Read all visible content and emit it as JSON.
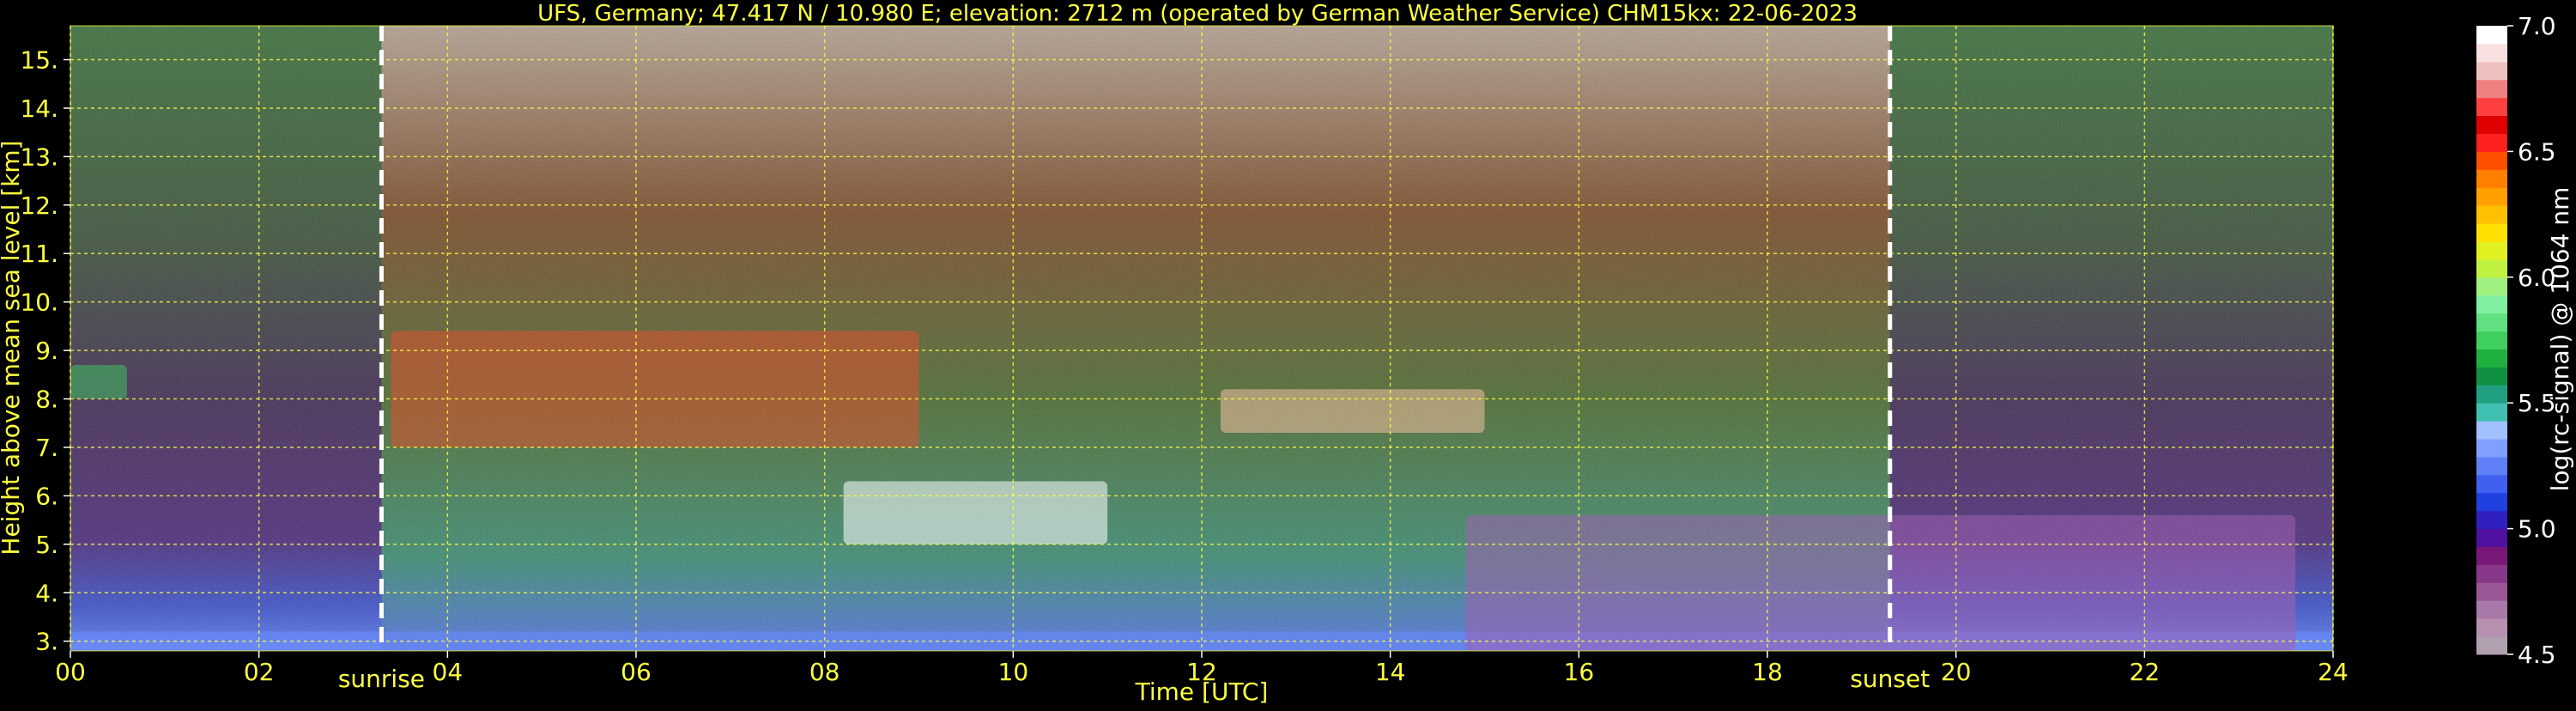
{
  "chart_data": {
    "type": "heatmap",
    "title": "UFS, Germany; 47.417 N / 10.980 E; elevation: 2712 m  (operated by German Weather Service)    CHM15kx: 22-06-2023",
    "xlabel": "Time [UTC]",
    "ylabel": "Height above mean sea level [km]",
    "xlim": [
      0,
      24
    ],
    "ylim": [
      2.8,
      15.7
    ],
    "x_ticks": [
      "00",
      "02",
      "04",
      "06",
      "08",
      "10",
      "12",
      "14",
      "16",
      "18",
      "20",
      "22",
      "24"
    ],
    "y_ticks": [
      "3.",
      "4.",
      "5.",
      "6.",
      "7.",
      "8.",
      "9.",
      "10.",
      "11.",
      "12.",
      "13.",
      "14.",
      "15."
    ],
    "grid": true,
    "annotations": [
      {
        "text": "sunrise",
        "x": 3.3
      },
      {
        "text": "sunset",
        "x": 19.3
      }
    ],
    "colorbar": {
      "label": "log(rc-signal) @ 1064 nm",
      "range": [
        4.5,
        7.0
      ],
      "ticks": [
        "4.5",
        "5.0",
        "5.5",
        "6.0",
        "6.5",
        "7.0"
      ],
      "colors": [
        "#b0a0b0",
        "#b890b0",
        "#a878a8",
        "#985898",
        "#883888",
        "#781878",
        "#5010a0",
        "#3020c0",
        "#2040e0",
        "#4060f0",
        "#6080f8",
        "#80a0ff",
        "#a0c0ff",
        "#40c0b0",
        "#20a080",
        "#109040",
        "#20b040",
        "#40d060",
        "#60e080",
        "#80f0a0",
        "#a0f080",
        "#c0f040",
        "#e0f020",
        "#ffe000",
        "#ffc000",
        "#ffa000",
        "#ff8000",
        "#ff5000",
        "#ff2020",
        "#e00000",
        "#ff4040",
        "#f08080",
        "#f0c0c0",
        "#f8e0e0",
        "#ffffff"
      ]
    },
    "features": [
      {
        "name": "boundary-layer",
        "x": [
          0,
          24
        ],
        "y": [
          2.8,
          3.2
        ]
      },
      {
        "name": "cirrus-layer-early",
        "x": [
          0,
          0.6
        ],
        "y": [
          8.0,
          8.7
        ]
      },
      {
        "name": "cirrus-layer-morning",
        "x": [
          3.4,
          9.0
        ],
        "y": [
          7.0,
          9.4
        ]
      },
      {
        "name": "cloud-layer-midday",
        "x": [
          8.2,
          11.0
        ],
        "y": [
          5.0,
          6.3
        ]
      },
      {
        "name": "cloud-layer-afternoon",
        "x": [
          12.2,
          15.0
        ],
        "y": [
          7.3,
          8.2
        ]
      },
      {
        "name": "convective-clouds",
        "x": [
          14.8,
          23.6
        ],
        "y": [
          2.8,
          5.6
        ]
      }
    ]
  }
}
